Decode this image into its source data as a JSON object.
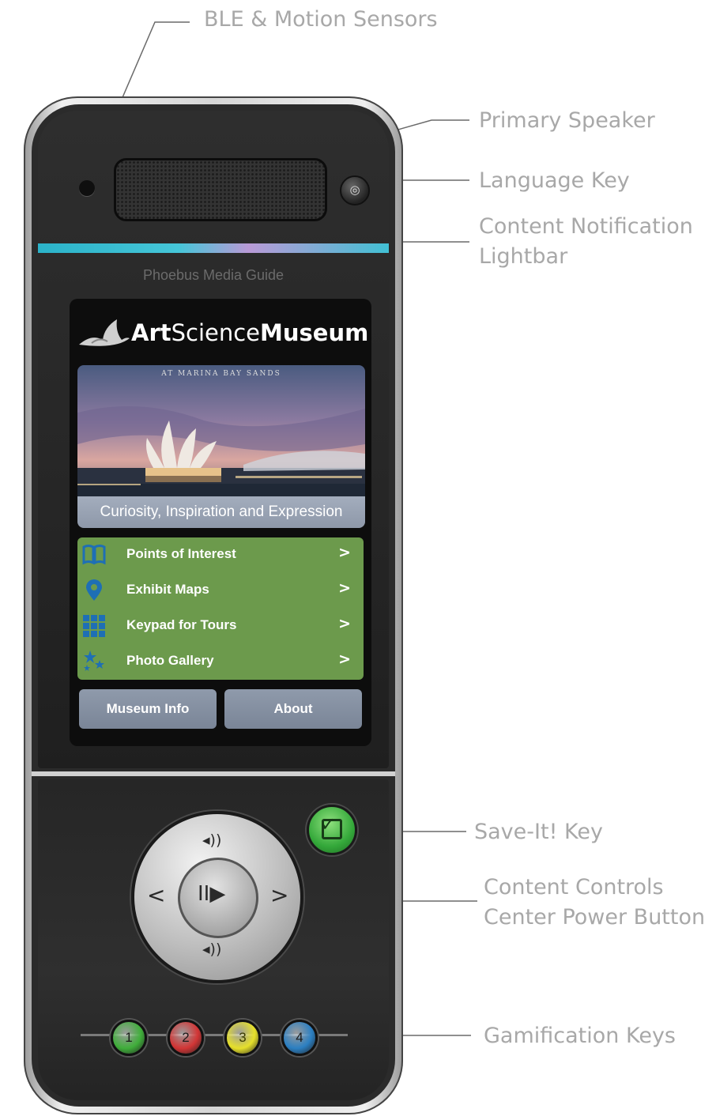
{
  "callouts": {
    "ble": "BLE & Motion Sensors",
    "speaker": "Primary Speaker",
    "language": "Language Key",
    "lightbar_1": "Content Notification",
    "lightbar_2": "Lightbar",
    "save": "Save-It! Key",
    "controls_1": "Content Controls",
    "controls_2": "Center Power Button",
    "gamification": "Gamification Keys"
  },
  "device": {
    "brand": "Phoebus Media Guide",
    "screen": {
      "logo_part1": "Art",
      "logo_part2": "Science",
      "logo_part3": "Museum",
      "photo_caption": "AT MARINA BAY SANDS",
      "tagline": "Curiosity, Inspiration and Expression",
      "menu": [
        {
          "label": "Points of Interest",
          "icon": "book-icon",
          "chevron": ">"
        },
        {
          "label": "Exhibit Maps",
          "icon": "map-pin-icon",
          "chevron": ">"
        },
        {
          "label": "Keypad for Tours",
          "icon": "keypad-grid-icon",
          "chevron": ">"
        },
        {
          "label": "Photo Gallery",
          "icon": "stars-icon",
          "chevron": ">"
        }
      ],
      "buttons": {
        "museum_info": "Museum Info",
        "about": "About"
      }
    },
    "controls": {
      "volume_up": "◂))",
      "volume_down": "◂))",
      "prev": "<",
      "next": ">",
      "center": "II▶"
    },
    "game_keys": [
      {
        "label": "1",
        "color": "#3fae3a"
      },
      {
        "label": "2",
        "color": "#d23535"
      },
      {
        "label": "3",
        "color": "#e6e02a"
      },
      {
        "label": "4",
        "color": "#2b7fc2"
      }
    ],
    "colors": {
      "lightbar": "#3ec3d6",
      "menu_green": "#6c9a4c",
      "icon_blue": "#1e6fb5"
    }
  }
}
